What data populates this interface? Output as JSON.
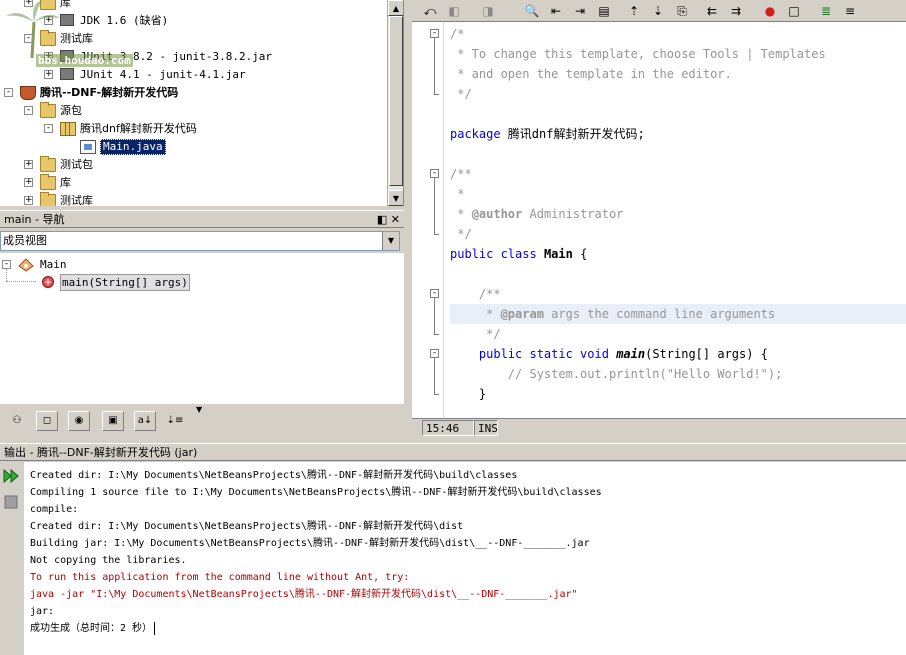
{
  "project_tree": {
    "rows": [
      {
        "label": "库",
        "indent": 1,
        "expander": "+",
        "icon": "folder-icon"
      },
      {
        "label": "JDK 1.6 (缺省)",
        "indent": 2,
        "expander": "+",
        "icon": "jar-icon"
      },
      {
        "label": "测试库",
        "indent": 1,
        "expander": "-",
        "icon": "folder-icon"
      },
      {
        "label": "JUnit 3.8.2 - junit-3.8.2.jar",
        "indent": 2,
        "expander": "+",
        "icon": "jar-icon"
      },
      {
        "label": "JUnit 4.1 - junit-4.1.jar",
        "indent": 2,
        "expander": "+",
        "icon": "jar-icon"
      },
      {
        "label": "腾讯--DNF-解封新开发代码",
        "indent": 0,
        "expander": "-",
        "icon": "java-project-icon",
        "bold": true
      },
      {
        "label": "源包",
        "indent": 1,
        "expander": "-",
        "icon": "folder-icon"
      },
      {
        "label": "腾讯dnf解封新开发代码",
        "indent": 2,
        "expander": "-",
        "icon": "package-icon"
      },
      {
        "label": "Main.java",
        "indent": 3,
        "expander": "",
        "icon": "java-file-icon",
        "selected": true
      },
      {
        "label": "测试包",
        "indent": 1,
        "expander": "+",
        "icon": "folder-icon"
      },
      {
        "label": "库",
        "indent": 1,
        "expander": "+",
        "icon": "folder-icon"
      },
      {
        "label": "测试库",
        "indent": 1,
        "expander": "+",
        "icon": "folder-icon"
      }
    ],
    "watermark": "bbs.houdao.com"
  },
  "navigator": {
    "title": "main - 导航",
    "title_buttons": "◧ ✕",
    "view_combo": "成员视图",
    "tree": [
      {
        "label": "Main",
        "icon": "class-icon"
      },
      {
        "label": "main(String[] args)",
        "icon": "method-icon"
      }
    ]
  },
  "editor": {
    "lines": [
      {
        "fold": "-",
        "segments": [
          {
            "t": "/*",
            "c": "cmt"
          }
        ]
      },
      {
        "segments": [
          {
            "t": " * To change this template, choose Tools | Templates",
            "c": "cmt"
          }
        ]
      },
      {
        "segments": [
          {
            "t": " * and open the template in the editor.",
            "c": "cmt"
          }
        ]
      },
      {
        "fold_end": true,
        "segments": [
          {
            "t": " */",
            "c": "cmt"
          }
        ]
      },
      {
        "segments": []
      },
      {
        "segments": [
          {
            "t": "package",
            "c": "kw"
          },
          {
            "t": " 腾讯dnf解封新开发代码;",
            "c": ""
          }
        ]
      },
      {
        "segments": []
      },
      {
        "fold": "-",
        "segments": [
          {
            "t": "/**",
            "c": "cmt"
          }
        ]
      },
      {
        "segments": [
          {
            "t": " *",
            "c": "cmt"
          }
        ]
      },
      {
        "segments": [
          {
            "t": " * ",
            "c": "cmt"
          },
          {
            "t": "@author",
            "c": "tag"
          },
          {
            "t": " Administrator",
            "c": "cmt"
          }
        ]
      },
      {
        "fold_end": true,
        "segments": [
          {
            "t": " */",
            "c": "cmt"
          }
        ]
      },
      {
        "segments": [
          {
            "t": "public class",
            "c": "kw"
          },
          {
            "t": " ",
            "c": ""
          },
          {
            "t": "Main",
            "c": "cls"
          },
          {
            "t": " {",
            "c": ""
          }
        ]
      },
      {
        "segments": []
      },
      {
        "fold": "-",
        "segments": [
          {
            "t": "    /**",
            "c": "cmt"
          }
        ]
      },
      {
        "highlight": true,
        "segments": [
          {
            "t": "     * ",
            "c": "cmt"
          },
          {
            "t": "@param",
            "c": "tag"
          },
          {
            "t": " args the command line arguments",
            "c": "cmt"
          }
        ]
      },
      {
        "fold_end": true,
        "segments": [
          {
            "t": "     */",
            "c": "cmt"
          }
        ]
      },
      {
        "fold": "-",
        "segments": [
          {
            "t": "    ",
            "c": ""
          },
          {
            "t": "public static void",
            "c": "kw"
          },
          {
            "t": " ",
            "c": ""
          },
          {
            "t": "main",
            "c": "fn"
          },
          {
            "t": "(String[] args) {",
            "c": ""
          }
        ]
      },
      {
        "segments": [
          {
            "t": "        // System.out.println(\"Hello World!\");",
            "c": "cmt"
          }
        ]
      },
      {
        "fold_end": true,
        "segments": [
          {
            "t": "    }",
            "c": ""
          }
        ]
      }
    ],
    "status_position": "15:46",
    "status_mode": "INS"
  },
  "output": {
    "title": "输出 - 腾讯--DNF-解封新开发代码 (jar)",
    "lines": [
      {
        "text": "Created dir: I:\\My Documents\\NetBeansProjects\\腾讯--DNF-解封新开发代码\\build\\classes",
        "red": false
      },
      {
        "text": "Compiling 1 source file to I:\\My Documents\\NetBeansProjects\\腾讯--DNF-解封新开发代码\\build\\classes",
        "red": false
      },
      {
        "text": "compile:",
        "red": false
      },
      {
        "text": "Created dir: I:\\My Documents\\NetBeansProjects\\腾讯--DNF-解封新开发代码\\dist",
        "red": false
      },
      {
        "text": "Building jar: I:\\My Documents\\NetBeansProjects\\腾讯--DNF-解封新开发代码\\dist\\__--DNF-_______.jar",
        "red": false
      },
      {
        "text": "Not copying the libraries.",
        "red": false
      },
      {
        "text": "To run this application from the command line without Ant, try:",
        "red": true
      },
      {
        "text": "java -jar \"I:\\My Documents\\NetBeansProjects\\腾讯--DNF-解封新开发代码\\dist\\__--DNF-_______.jar\"",
        "red": true
      },
      {
        "text": "jar:",
        "red": false
      },
      {
        "text": "成功生成（总时间：2 秒）",
        "red": false
      }
    ]
  },
  "colors": {
    "keyword": "#0000e6",
    "comment": "#969696",
    "error_text": "#b00000",
    "selection": "#0a246a",
    "chrome": "#d4d0c8"
  }
}
